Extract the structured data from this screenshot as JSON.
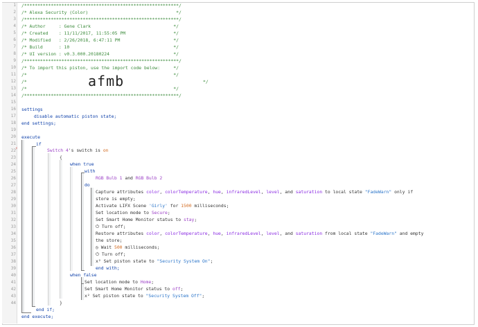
{
  "gutter": {
    "line_numbers": [
      "1",
      "2",
      "3",
      "4",
      "5",
      "6",
      "7",
      "8",
      "9",
      "10",
      "11",
      "12",
      "13",
      "14",
      "15",
      "16",
      "17",
      "18",
      "19",
      "20",
      "21",
      "22",
      "23",
      "24",
      "25",
      "26",
      "27",
      "28",
      "29",
      "30",
      "31",
      "32",
      "33",
      "34",
      "35",
      "36",
      "37",
      "38",
      "39",
      "40",
      "41",
      "42",
      "43",
      "44"
    ],
    "marker_line22": "⚡"
  },
  "header_comment": {
    "rule": "/**********************************************************/",
    "line2": "/* Alexa Security (Color)                                 */",
    "line4": "/* Author     : Gene Clark                               */",
    "line5": "/* Created    : 11/11/2017, 11:55:05 PM                  */",
    "line6": "/* Modified   : 2/26/2018, 6:47:11 PM                    */",
    "line7": "/* Build      : 10                                       */",
    "line8": "/* UI version : v0.3.000.20180224                        */",
    "line10": "/* To import this piston, use the import code below:     */",
    "blank": "/*                                                       */",
    "line12_left": "/*",
    "line12_right": "*/",
    "import_code": "afmb"
  },
  "settings": {
    "open": "settings",
    "item": "disable automatic piston state;",
    "close": "end settings;"
  },
  "execute": {
    "open": "execute",
    "if": "if",
    "cond_device": "Switch 4",
    "cond_mid": "'s switch is",
    "cond_val": "on",
    "brace_open": "{",
    "when_true": "when true",
    "with": "with",
    "dev1": "RGB Bulb 1",
    "and": "and",
    "dev2": "RGB Bulb 2",
    "do": "do",
    "l28a_pre": "Capture attributes",
    "a_color": "color",
    "a_ct": "colorTemperature",
    "a_hue": "hue",
    "a_ir": "infraredLevel",
    "a_level": "level",
    "a_sat": "saturation",
    "l28_and": ", and",
    "l28_to": "to local state",
    "l28_state": "\"FadeWarn\"",
    "l28_only": "only if",
    "l28b": "store is empty;",
    "l30_pre": "Activate LIFX Scene",
    "l30_scene": "'Girly'",
    "l30_for": "for",
    "l30_num": "1500",
    "l30_unit": "milliseconds;",
    "l31_pre": "Set location mode to",
    "l31_val": "Secure",
    "l32_pre": "Set Smart Home Monitor status to",
    "l32_val": "stay",
    "turn_off": "Turn off;",
    "l34a_pre": "Restore attributes",
    "l34_from": "from local state",
    "l34_state": "\"FadeWarn\"",
    "l34_empty": "and empty",
    "l34b": "the store;",
    "l35_pre": "Wait",
    "l35_num": "500",
    "l35_unit": "milliseconds;",
    "l37_pre": "Set piston state to",
    "l37_val": "\"Security System On\"",
    "end_with": "end with;",
    "when_false": "when false",
    "l39_pre": "Set location mode to",
    "l39_val": "Home",
    "l40_pre": "Set Smart Home Monitor status to",
    "l40_val": "off",
    "l41_pre": "Set piston state to",
    "l41_val": "\"Security System Off\"",
    "brace_close": "}",
    "end_if": "end if;",
    "close": "end execute;"
  }
}
